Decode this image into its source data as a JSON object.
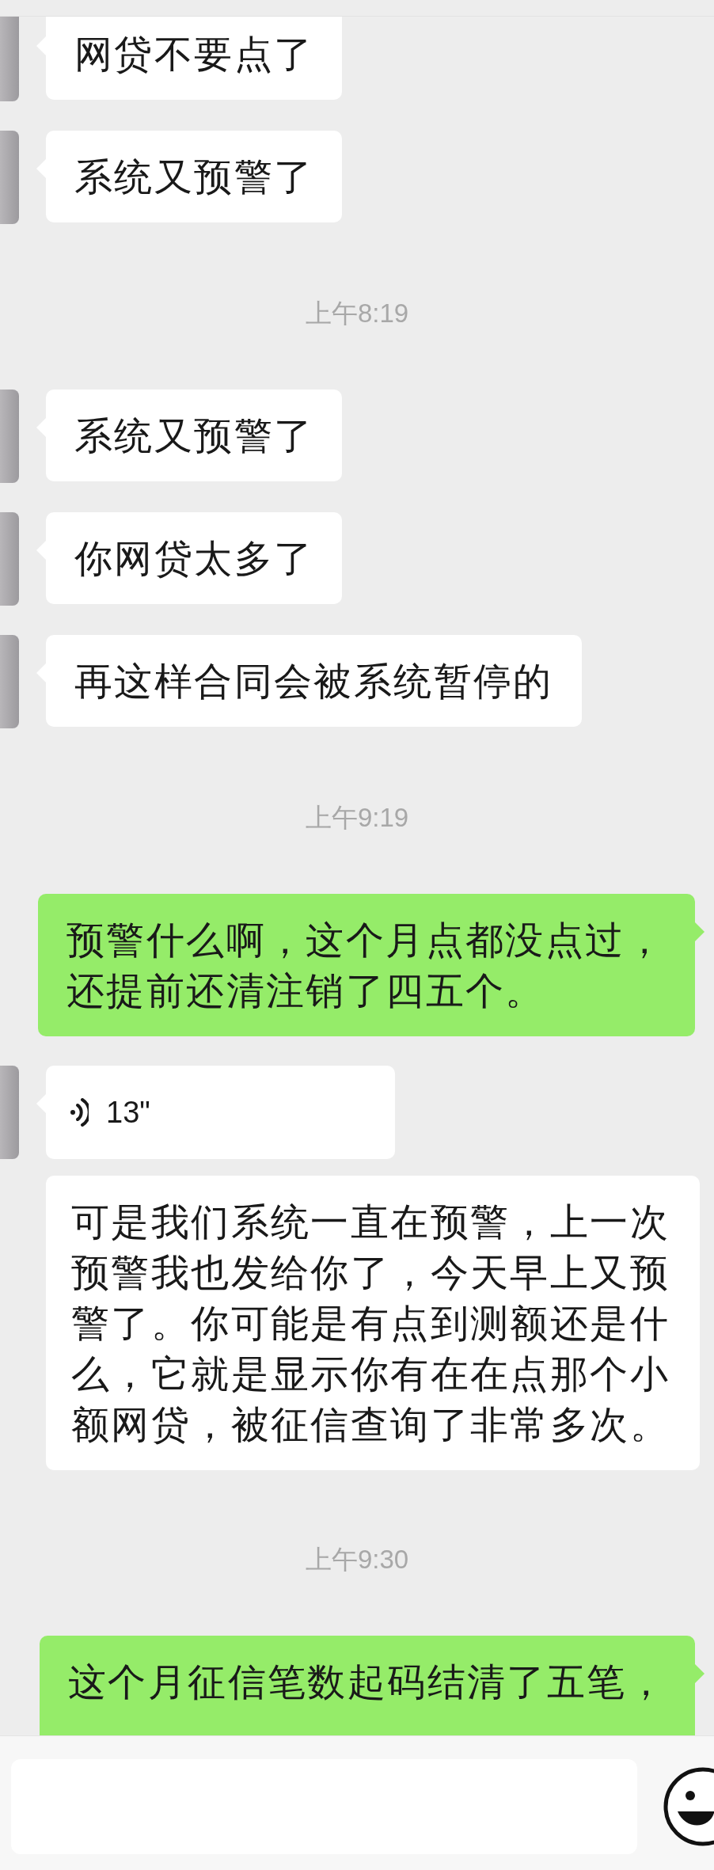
{
  "messages": [
    {
      "kind": "text",
      "outgoing": false,
      "text": "网贷不要点了"
    },
    {
      "kind": "text",
      "outgoing": false,
      "text": "系统又预警了"
    },
    {
      "kind": "time",
      "text": "上午8:19"
    },
    {
      "kind": "text",
      "outgoing": false,
      "text": "系统又预警了"
    },
    {
      "kind": "text",
      "outgoing": false,
      "text": "你网贷太多了"
    },
    {
      "kind": "text",
      "outgoing": false,
      "text": "再这样合同会被系统暂停的"
    },
    {
      "kind": "time",
      "text": "上午9:19"
    },
    {
      "kind": "text",
      "outgoing": true,
      "text": "预警什么啊，这个月点都没点过，还提前还清注销了四五个。"
    },
    {
      "kind": "voice",
      "outgoing": false,
      "duration": "13\"",
      "transcript": "可是我们系统一直在预警，上一次预警我也发给你了，今天早上又预警了。你可能是有点到测额还是什么，它就是显示你有在在点那个小额网贷，被征信查询了非常多次。"
    },
    {
      "kind": "time",
      "text": "上午9:30"
    },
    {
      "kind": "text",
      "outgoing": true,
      "text": "这个月征信笔数起码结清了五笔，"
    }
  ]
}
